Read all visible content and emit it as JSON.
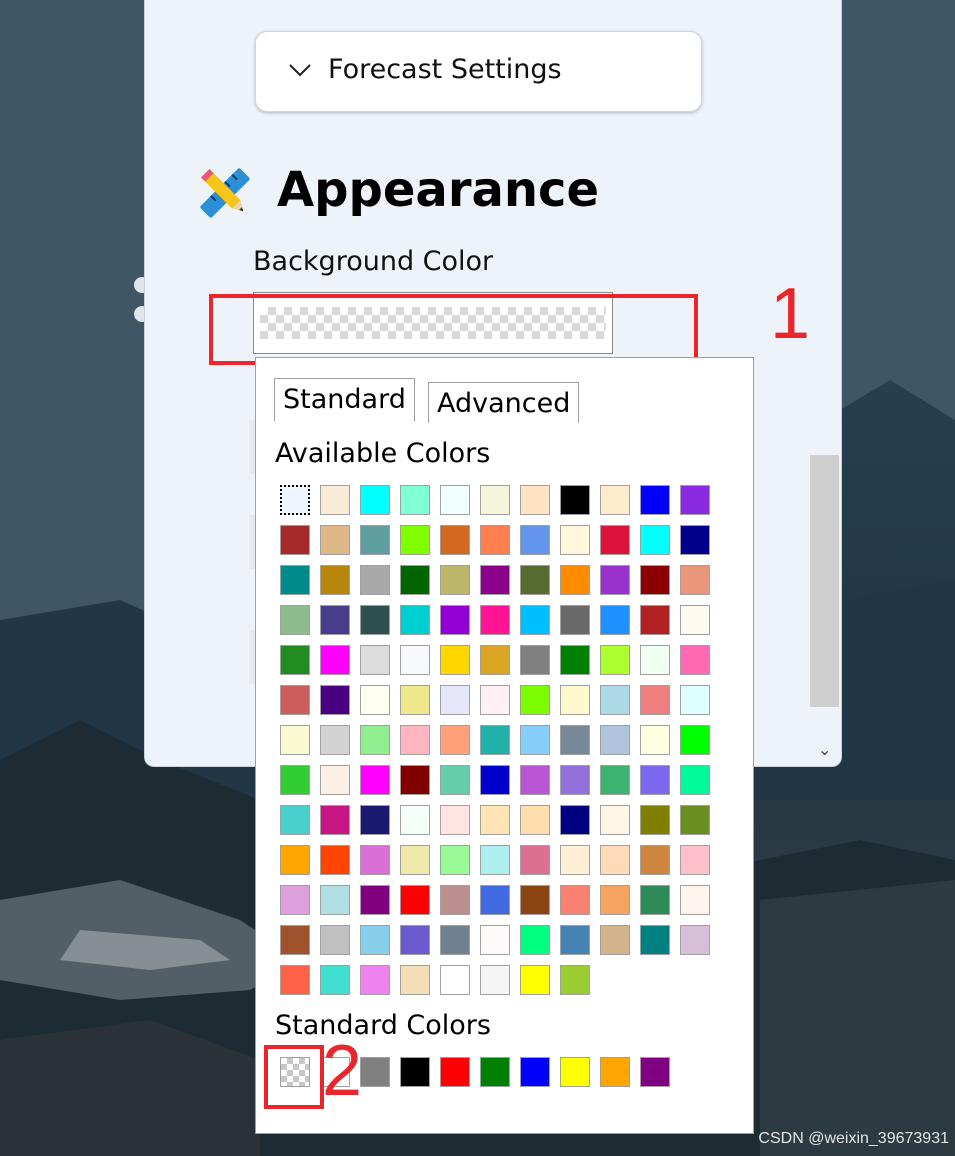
{
  "expander": {
    "title": "Forecast Settings"
  },
  "section": {
    "title": "Appearance",
    "icon": "pencil-ruler-icon"
  },
  "background_color": {
    "label": "Background Color",
    "value": "transparent"
  },
  "annotations": {
    "marker_1": "1",
    "marker_2": "2",
    "color": "#e8262b"
  },
  "popup": {
    "tabs": [
      "Standard",
      "Advanced"
    ],
    "active_tab": "Standard",
    "available_label": "Available Colors",
    "standard_label": "Standard Colors",
    "available_colors": [
      [
        "transparent-selected",
        "#faebd7",
        "#00ffff",
        "#7fffd4",
        "#f0ffff",
        "#f5f5dc",
        "#ffe4c4",
        "#000000",
        "#ffebcd",
        "#0000ff",
        "#8a2be2"
      ],
      [
        "#a52a2a",
        "#deb887",
        "#5f9ea0",
        "#7fff00",
        "#d2691e",
        "#ff7f50",
        "#6495ed",
        "#fff8dc",
        "#dc143c",
        "#00ffff",
        "#00008b"
      ],
      [
        "#008b8b",
        "#b8860b",
        "#a9a9a9",
        "#006400",
        "#bdb76b",
        "#8b008b",
        "#556b2f",
        "#ff8c00",
        "#9932cc",
        "#8b0000",
        "#e9967a"
      ],
      [
        "#8fbc8f",
        "#483d8b",
        "#2f4f4f",
        "#00ced1",
        "#9400d3",
        "#ff1493",
        "#00bfff",
        "#696969",
        "#1e90ff",
        "#b22222",
        "#fffaf0"
      ],
      [
        "#228b22",
        "#ff00ff",
        "#dcdcdc",
        "#f8f8ff",
        "#ffd700",
        "#daa520",
        "#808080",
        "#008000",
        "#adff2f",
        "#f0fff0",
        "#ff69b4"
      ],
      [
        "#cd5c5c",
        "#4b0082",
        "#fffff0",
        "#f0e68c",
        "#e6e6fa",
        "#fff0f5",
        "#7cfc00",
        "#fffacd",
        "#add8e6",
        "#f08080",
        "#e0ffff"
      ],
      [
        "#fafad2",
        "#d3d3d3",
        "#90ee90",
        "#ffb6c1",
        "#ffa07a",
        "#20b2aa",
        "#87cefa",
        "#778899",
        "#b0c4de",
        "#ffffe0",
        "#00ff00"
      ],
      [
        "#32cd32",
        "#faf0e6",
        "#ff00ff",
        "#800000",
        "#66cdaa",
        "#0000cd",
        "#ba55d3",
        "#9370db",
        "#3cb371",
        "#7b68ee",
        "#00fa9a"
      ],
      [
        "#48d1cc",
        "#c71585",
        "#191970",
        "#f5fffa",
        "#ffe4e1",
        "#ffe4b5",
        "#ffdead",
        "#000080",
        "#fdf5e6",
        "#808000",
        "#6b8e23"
      ],
      [
        "#ffa500",
        "#ff4500",
        "#da70d6",
        "#eee8aa",
        "#98fb98",
        "#afeeee",
        "#db7093",
        "#ffefd5",
        "#ffdab9",
        "#cd853f",
        "#ffc0cb"
      ],
      [
        "#dda0dd",
        "#b0e0e6",
        "#800080",
        "#ff0000",
        "#bc8f8f",
        "#4169e1",
        "#8b4513",
        "#fa8072",
        "#f4a460",
        "#2e8b57",
        "#fff5ee"
      ],
      [
        "#a0522d",
        "#c0c0c0",
        "#87ceeb",
        "#6a5acd",
        "#708090",
        "#fffafa",
        "#00ff7f",
        "#4682b4",
        "#d2b48c",
        "#008080",
        "#d8bfd8"
      ],
      [
        "#ff6347",
        "#40e0d0",
        "#ee82ee",
        "#f5deb3",
        "#ffffff",
        "#f5f5f5",
        "#ffff00",
        "#9acd32"
      ]
    ],
    "standard_colors": [
      "transparent",
      "#ffffff",
      "#808080",
      "#000000",
      "#ff0000",
      "#008000",
      "#0000ff",
      "#ffff00",
      "#ffa500",
      "#800080"
    ]
  },
  "watermark": "CSDN @weixin_39673931"
}
